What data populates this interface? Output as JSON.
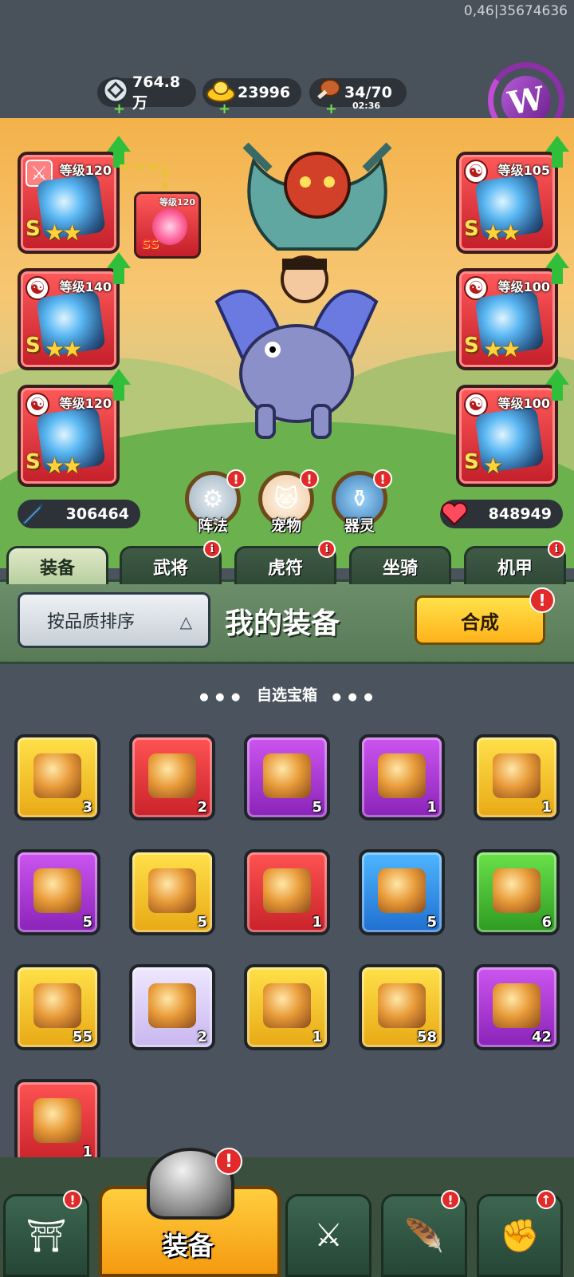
{
  "debug": "0,46|35674636",
  "resources": {
    "silver": {
      "value": "764.8万",
      "icon": "silver-coin-icon"
    },
    "gold": {
      "value": "23996",
      "icon": "gold-ingot-icon"
    },
    "food": {
      "value": "34/70",
      "timer": "02:36",
      "icon": "meat-icon"
    }
  },
  "logo": {
    "letter": "W"
  },
  "equipment_slots": {
    "left": [
      {
        "level": "等级120",
        "grade": "S",
        "stars": "★★"
      },
      {
        "level": "等级140",
        "grade": "S",
        "stars": "★★"
      },
      {
        "level": "等级120",
        "grade": "S",
        "stars": "★★"
      }
    ],
    "right": [
      {
        "level": "等级105",
        "grade": "S",
        "stars": "★★"
      },
      {
        "level": "等级100",
        "grade": "S",
        "stars": "★★"
      },
      {
        "level": "等级100",
        "grade": "S",
        "stars": "★"
      }
    ]
  },
  "pet_slot": {
    "level": "等级120",
    "grade": "SS"
  },
  "stats": {
    "attack": "306464",
    "hp": "848949"
  },
  "features": [
    {
      "label": "阵法",
      "badge": "!"
    },
    {
      "label": "宠物",
      "badge": "!"
    },
    {
      "label": "器灵",
      "badge": "!"
    }
  ],
  "tabs": [
    {
      "label": "装备",
      "active": true,
      "badge": ""
    },
    {
      "label": "武将",
      "active": false,
      "badge": "i"
    },
    {
      "label": "虎符",
      "active": false,
      "badge": "i"
    },
    {
      "label": "坐骑",
      "active": false,
      "badge": ""
    },
    {
      "label": "机甲",
      "active": false,
      "badge": "i"
    }
  ],
  "panel": {
    "sort_label": "按品质排序",
    "sort_icon": "△",
    "title": "我的装备",
    "merge_label": "合成",
    "merge_badge": "!"
  },
  "section_title": "自选宝箱",
  "section_decor_left": "● ● ●",
  "section_decor_right": "● ● ●",
  "items": [
    {
      "color": "gold",
      "count": "3"
    },
    {
      "color": "red",
      "count": "2"
    },
    {
      "color": "purple",
      "count": "5"
    },
    {
      "color": "purple",
      "count": "1"
    },
    {
      "color": "gold",
      "count": "1"
    },
    {
      "color": "purple",
      "count": "5"
    },
    {
      "color": "gold",
      "count": "5"
    },
    {
      "color": "red",
      "count": "1"
    },
    {
      "color": "blue",
      "count": "5"
    },
    {
      "color": "green",
      "count": "6"
    },
    {
      "color": "gold",
      "count": "55"
    },
    {
      "color": "pale",
      "count": "2"
    },
    {
      "color": "gold",
      "count": "1"
    },
    {
      "color": "gold",
      "count": "58"
    },
    {
      "color": "purple",
      "count": "42"
    },
    {
      "color": "red",
      "count": "1"
    }
  ],
  "bottom_nav": {
    "main_label": "装备",
    "main_badge": "!",
    "badges": [
      "!",
      "",
      "!",
      "↑"
    ]
  }
}
